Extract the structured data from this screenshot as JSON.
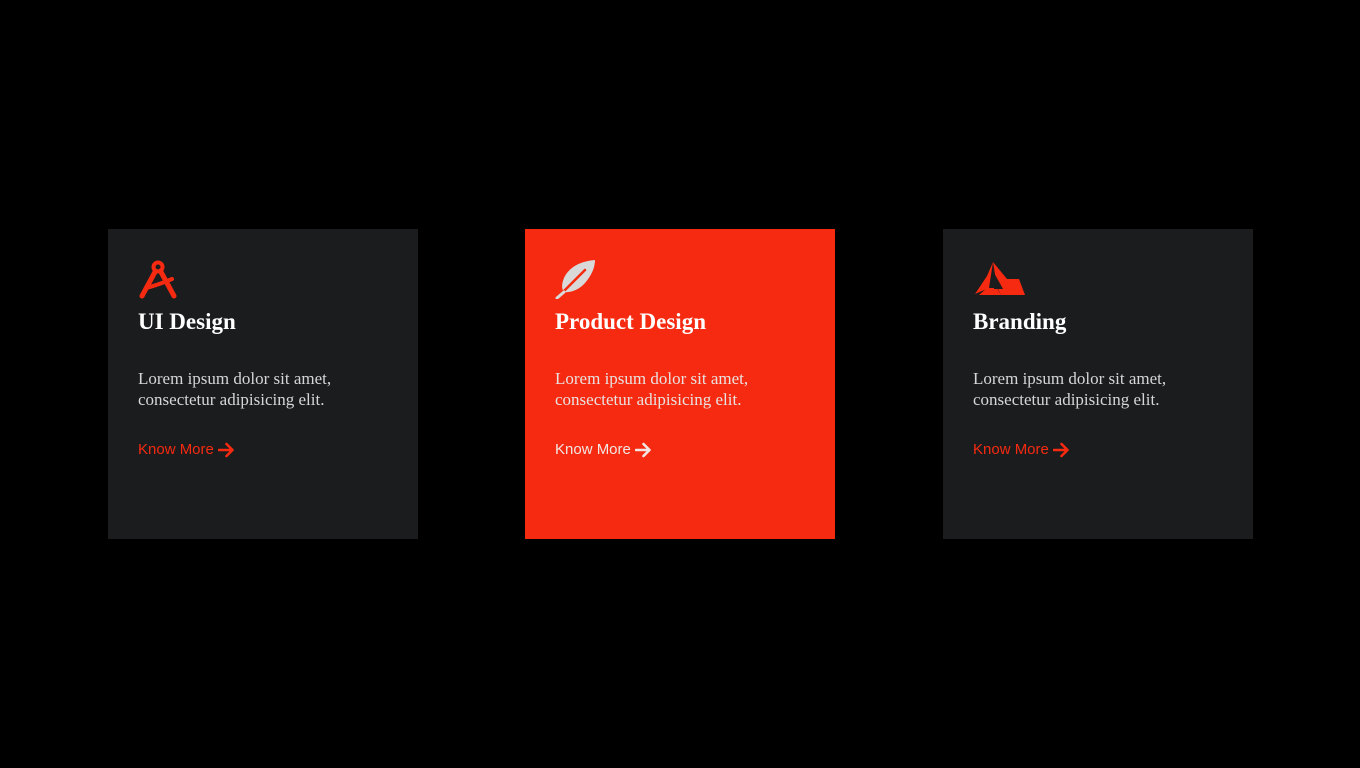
{
  "colors": {
    "background": "#000000",
    "card": "#1b1c1e",
    "accent": "#f52a10"
  },
  "cards": [
    {
      "icon": "drafting-compass-icon",
      "title": "UI Design",
      "text": "Lorem ipsum dolor sit amet, consectetur adipisicing elit.",
      "link": "Know More"
    },
    {
      "icon": "feather-icon",
      "title": "Product Design",
      "text": "Lorem ipsum dolor sit amet, consectetur adipisicing elit.",
      "link": "Know More"
    },
    {
      "icon": "brand-logo-icon",
      "title": "Branding",
      "text": "Lorem ipsum dolor sit amet, consectetur adipisicing elit.",
      "link": "Know More"
    }
  ]
}
